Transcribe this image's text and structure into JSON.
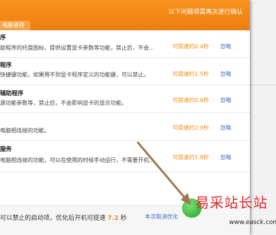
{
  "header": {
    "note": "以下问题项需再次进行确认",
    "tab_label": "电脑清理"
  },
  "rows": [
    {
      "title": "序",
      "desc": "助程序的托盘图标、提供设置显卡参数等功能，禁止后，不会...",
      "speed": "可提速约0.4秒",
      "ignore": "忽略"
    },
    {
      "title": "程序",
      "desc": "快捷键功能，如果用不到显卡程序定义的功能键，可以禁止。",
      "speed": "可提速约1.5秒",
      "ignore": "忽略"
    },
    {
      "title": "辅助程序",
      "desc": "源功能参数等，禁止后，不会影响显卡的显示功能。",
      "speed": "可提速约0.6秒",
      "ignore": "忽略"
    },
    {
      "title": "",
      "desc": "电脑相连接的功能。",
      "speed": "可提速约2.9秒",
      "ignore": "忽略"
    },
    {
      "title": "服务",
      "desc": "电脑相连接的功能，可以在使用的时候手动运行，不需要开机...",
      "speed": "可提速约1.8秒",
      "ignore": "忽略"
    }
  ],
  "footer": {
    "text_prefix": "可以禁止的启动项，优化后开机可提速",
    "seconds": "7.2",
    "seconds_unit": "秒",
    "cancel_link": "本次取消优化"
  },
  "watermark": {
    "text": "易采站长站",
    "url": "www.easck.com"
  },
  "colors": {
    "header_orange": "#f08a16",
    "speed_text": "#f08a16",
    "link_blue": "#3a6fc4",
    "arrow": "#a0774f"
  }
}
